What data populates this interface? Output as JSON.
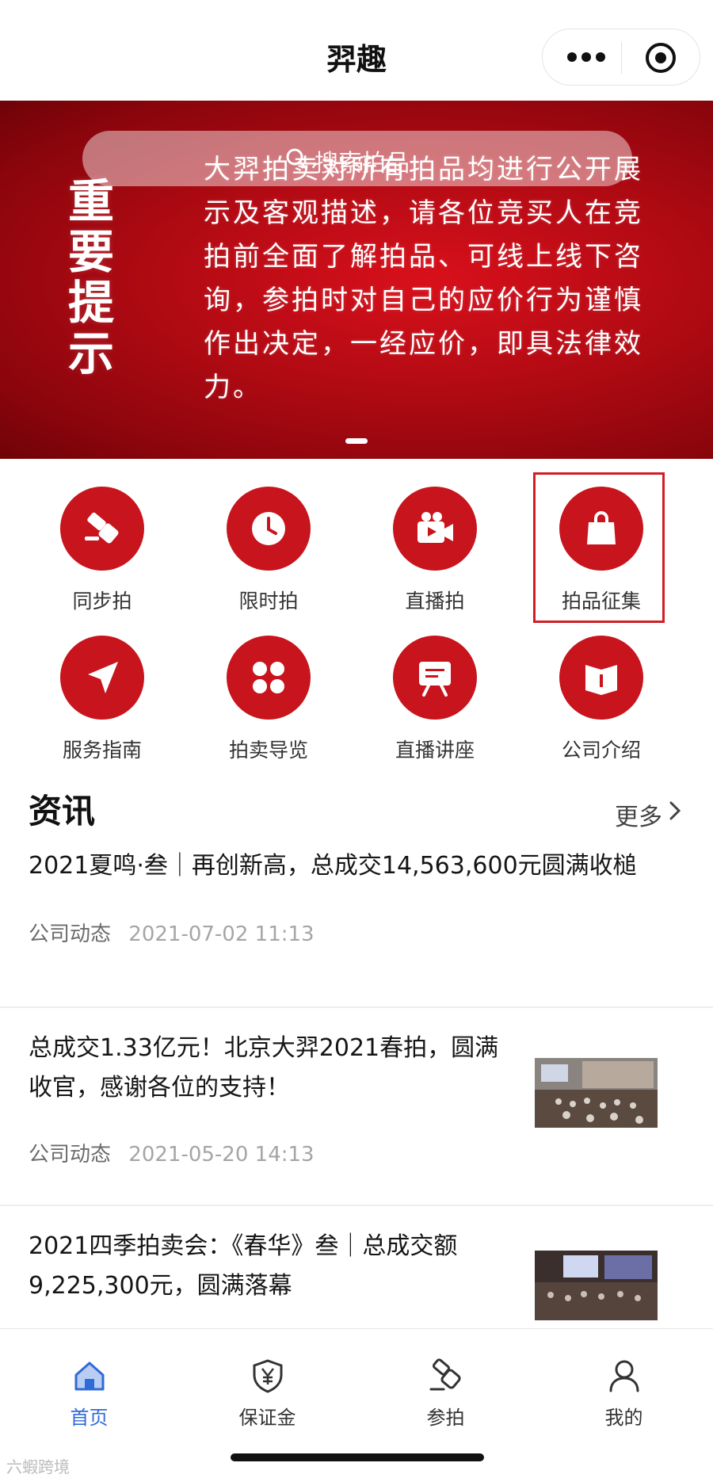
{
  "header": {
    "title": "羿趣"
  },
  "banner": {
    "heading": "重要提示",
    "body": "大羿拍卖对所有拍品均进行公开展示及客观描述，请各位竞买人在竞拍前全面了解拍品、可线上线下咨询，参拍时对自己的应价行为谨慎作出决定，一经应价，即具法律效力。",
    "search_placeholder": "搜索拍品"
  },
  "grid": {
    "items": [
      {
        "label": "同步拍",
        "icon": "gavel-icon"
      },
      {
        "label": "限时拍",
        "icon": "clock-icon"
      },
      {
        "label": "直播拍",
        "icon": "video-camera-icon"
      },
      {
        "label": "拍品征集",
        "icon": "shopping-bag-icon"
      },
      {
        "label": "服务指南",
        "icon": "navigation-arrow-icon"
      },
      {
        "label": "拍卖导览",
        "icon": "four-dots-icon"
      },
      {
        "label": "直播讲座",
        "icon": "lecture-board-icon"
      },
      {
        "label": "公司介绍",
        "icon": "book-icon"
      }
    ]
  },
  "news": {
    "title": "资讯",
    "more": "更多",
    "items": [
      {
        "headline": "2021夏鸣·叁｜再创新高，总成交14,563,600元圆满收槌",
        "category": "公司动态",
        "date": "2021-07-02 11:13"
      },
      {
        "headline": "总成交1.33亿元！北京大羿2021春拍，圆满收官，感谢各位的支持！",
        "category": "公司动态",
        "date": "2021-05-20 14:13"
      },
      {
        "headline": "2021四季拍卖会：《春华》叁｜总成交额9,225,300元，圆满落幕",
        "category": "",
        "date": ""
      }
    ]
  },
  "tabbar": {
    "tabs": [
      {
        "label": "首页",
        "icon": "home-icon"
      },
      {
        "label": "保证金",
        "icon": "shield-yen-icon"
      },
      {
        "label": "参拍",
        "icon": "gavel-icon"
      },
      {
        "label": "我的",
        "icon": "user-icon"
      }
    ]
  },
  "watermark": "六蝦跨境",
  "colors": {
    "accent": "#c8141d",
    "active_tab": "#2f6ad9",
    "banner_red": "#b00a13"
  }
}
